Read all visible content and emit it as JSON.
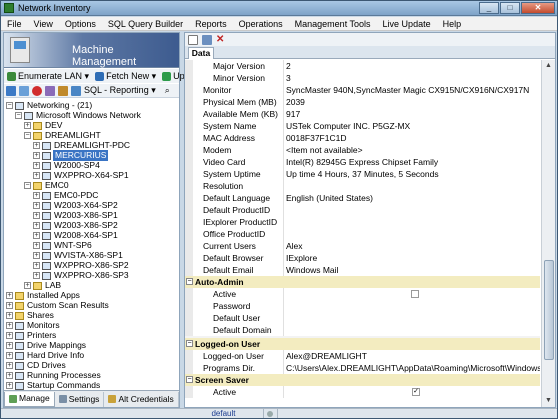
{
  "window": {
    "title": "Network Inventory",
    "min": "_",
    "max": "□",
    "close": "✕"
  },
  "menu": [
    "File",
    "View",
    "Options",
    "SQL Query Builder",
    "Reports",
    "Operations",
    "Management Tools",
    "Live Update",
    "Help"
  ],
  "left": {
    "banner_title": "Machine Management",
    "toolbar": {
      "enumerate": "Enumerate LAN",
      "fetch": "Fetch New",
      "update": "Update"
    },
    "toolbar2": {
      "sql_reporting": "SQL - Reporting"
    },
    "tree": [
      {
        "label": "Networking - (21)",
        "level": 0,
        "exp": "−",
        "folder": false
      },
      {
        "label": "Microsoft Windows Network",
        "level": 1,
        "exp": "−",
        "folder": false
      },
      {
        "label": "DEV",
        "level": 2,
        "exp": "+",
        "folder": true
      },
      {
        "label": "DREAMLIGHT",
        "level": 2,
        "exp": "−",
        "folder": true
      },
      {
        "label": "DREAMLIGHT-PDC",
        "level": 3,
        "exp": "+",
        "folder": false
      },
      {
        "label": "MERCURIUS",
        "level": 3,
        "exp": "+",
        "folder": false,
        "selected": true
      },
      {
        "label": "W2000-SP4",
        "level": 3,
        "exp": "+",
        "folder": false
      },
      {
        "label": "WXPPRO-X64-SP1",
        "level": 3,
        "exp": "+",
        "folder": false
      },
      {
        "label": "EMC0",
        "level": 2,
        "exp": "−",
        "folder": true
      },
      {
        "label": "EMC0-PDC",
        "level": 3,
        "exp": "+",
        "folder": false
      },
      {
        "label": "W2003-X64-SP2",
        "level": 3,
        "exp": "+",
        "folder": false
      },
      {
        "label": "W2003-X86-SP1",
        "level": 3,
        "exp": "+",
        "folder": false
      },
      {
        "label": "W2003-X86-SP2",
        "level": 3,
        "exp": "+",
        "folder": false
      },
      {
        "label": "W2008-X64-SP1",
        "level": 3,
        "exp": "+",
        "folder": false
      },
      {
        "label": "WNT-SP6",
        "level": 3,
        "exp": "+",
        "folder": false
      },
      {
        "label": "WVISTA-X86-SP1",
        "level": 3,
        "exp": "+",
        "folder": false
      },
      {
        "label": "WXPPRO-X86-SP2",
        "level": 3,
        "exp": "+",
        "folder": false
      },
      {
        "label": "WXPPRO-X86-SP3",
        "level": 3,
        "exp": "+",
        "folder": false
      },
      {
        "label": "LAB",
        "level": 2,
        "exp": "+",
        "folder": true
      },
      {
        "label": "Installed Apps",
        "level": 0,
        "exp": "+",
        "folder": true
      },
      {
        "label": "Custom Scan Results",
        "level": 0,
        "exp": "+",
        "folder": true
      },
      {
        "label": "Shares",
        "level": 0,
        "exp": "+",
        "folder": true
      },
      {
        "label": "Monitors",
        "level": 0,
        "exp": "+",
        "folder": false
      },
      {
        "label": "Printers",
        "level": 0,
        "exp": "+",
        "folder": false
      },
      {
        "label": "Drive Mappings",
        "level": 0,
        "exp": "+",
        "folder": false
      },
      {
        "label": "Hard Drive Info",
        "level": 0,
        "exp": "+",
        "folder": false
      },
      {
        "label": "CD Drives",
        "level": 0,
        "exp": "+",
        "folder": false
      },
      {
        "label": "Running Processes",
        "level": 0,
        "exp": "+",
        "folder": false
      },
      {
        "label": "Startup Commands",
        "level": 0,
        "exp": "+",
        "folder": false
      }
    ],
    "tabs": [
      "Manage",
      "Settings",
      "Alt Credentials"
    ]
  },
  "right": {
    "tab_label": "Data",
    "rows": [
      {
        "type": "row",
        "key": "Major Version",
        "value": "2",
        "indent": true
      },
      {
        "type": "row",
        "key": "Minor Version",
        "value": "3",
        "indent": true
      },
      {
        "type": "row",
        "key": "Monitor",
        "value": "SyncMaster 940N,SyncMaster Magic CX915N/CX916N/CX917N"
      },
      {
        "type": "row",
        "key": "Physical Mem (MB)",
        "value": "2039"
      },
      {
        "type": "row",
        "key": "Available Mem (KB)",
        "value": "917"
      },
      {
        "type": "row",
        "key": "System Name",
        "value": "USTek Computer INC. P5GZ-MX"
      },
      {
        "type": "row",
        "key": "MAC Address",
        "value": "0018F37F1C1D"
      },
      {
        "type": "row",
        "key": "Modem",
        "value": "<Item not available>"
      },
      {
        "type": "row",
        "key": "Video Card",
        "value": "Intel(R) 82945G Express Chipset Family"
      },
      {
        "type": "row",
        "key": "System Uptime",
        "value": "Up time 4 Hours, 37 Minutes, 5 Seconds"
      },
      {
        "type": "row",
        "key": "Resolution",
        "value": ""
      },
      {
        "type": "row",
        "key": "Default Language",
        "value": "English (United States)"
      },
      {
        "type": "row",
        "key": "Default ProductID",
        "value": ""
      },
      {
        "type": "row",
        "key": "IExplorer ProductID",
        "value": ""
      },
      {
        "type": "row",
        "key": "Office ProductID",
        "value": ""
      },
      {
        "type": "row",
        "key": "Current Users",
        "value": "Alex"
      },
      {
        "type": "row",
        "key": "Default Browser",
        "value": "IExplore"
      },
      {
        "type": "row",
        "key": "Default Email",
        "value": "Windows Mail"
      },
      {
        "type": "section",
        "key": "Auto-Admin",
        "box": "−"
      },
      {
        "type": "row",
        "key": "Active",
        "value": "",
        "indent": true,
        "check": ""
      },
      {
        "type": "row",
        "key": "Password",
        "value": "",
        "indent": true
      },
      {
        "type": "row",
        "key": "Default User",
        "value": "",
        "indent": true
      },
      {
        "type": "row",
        "key": "Default Domain",
        "value": "",
        "indent": true
      },
      {
        "type": "separator"
      },
      {
        "type": "section",
        "key": "Logged-on User",
        "box": "−"
      },
      {
        "type": "row",
        "key": "Logged-on User",
        "value": "Alex@DREAMLIGHT"
      },
      {
        "type": "row",
        "key": "Programs Dir.",
        "value": "C:\\Users\\Alex.DREAMLIGHT\\AppData\\Roaming\\Microsoft\\Windows\\"
      },
      {
        "type": "section",
        "key": "Screen Saver",
        "box": "−"
      },
      {
        "type": "row",
        "key": "Active",
        "value": "",
        "indent": true,
        "check": "✓"
      }
    ]
  },
  "status": {
    "label": "default"
  },
  "colors": {
    "section_bg": "#f3ecc0",
    "selection": "#3a74c4",
    "banner": "#3d5b8f"
  }
}
